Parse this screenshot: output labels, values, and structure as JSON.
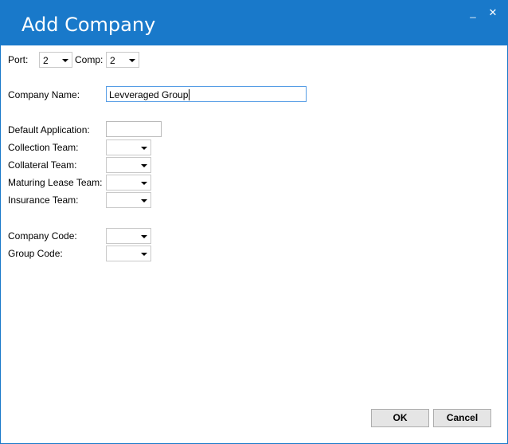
{
  "window": {
    "title": "Add Company",
    "minimize_glyph": "_",
    "close_glyph": "✕",
    "accent_color": "#1979ca"
  },
  "selectors": {
    "port_label": "Port:",
    "port_value": "2",
    "comp_label": "Comp:",
    "comp_value": "2"
  },
  "form": {
    "company_name_label": "Company Name:",
    "company_name_value": "Levveraged Group",
    "default_application_label": "Default Application:",
    "default_application_value": "",
    "collection_team_label": "Collection Team:",
    "collection_team_value": "",
    "collateral_team_label": "Collateral Team:",
    "collateral_team_value": "",
    "maturing_lease_team_label": "Maturing Lease Team:",
    "maturing_lease_team_value": "",
    "insurance_team_label": "Insurance Team:",
    "insurance_team_value": "",
    "company_code_label": "Company Code:",
    "company_code_value": "",
    "group_code_label": "Group Code:",
    "group_code_value": ""
  },
  "buttons": {
    "ok_label": "OK",
    "cancel_label": "Cancel"
  },
  "icons": {
    "dropdown": "chevron-down-icon",
    "minimize": "minimize-icon",
    "close": "close-icon"
  }
}
